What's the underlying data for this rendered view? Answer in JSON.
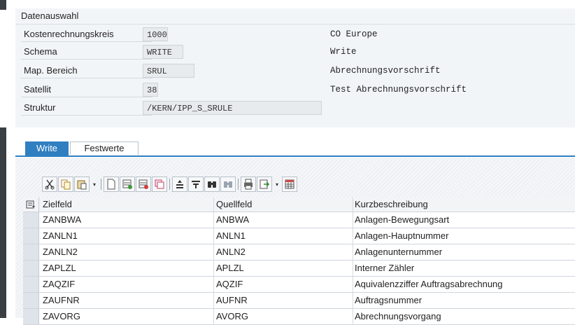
{
  "group": {
    "title": "Datenauswahl",
    "fields": [
      {
        "label": "Kostenrechnungskreis",
        "value": "1000",
        "description": "CO Europe"
      },
      {
        "label": "Schema",
        "value": "WRITE",
        "description": "Write"
      },
      {
        "label": "Map. Bereich",
        "value": "SRUL",
        "description": "Abrechnungsvorschrift"
      },
      {
        "label": "Satellit",
        "value": "38",
        "description": "Test Abrechnungsvorschrift"
      },
      {
        "label": "Struktur",
        "value": "/KERN/IPP_S_SRULE",
        "description": ""
      }
    ]
  },
  "tabs": [
    {
      "label": "Write",
      "active": true
    },
    {
      "label": "Festwerte",
      "active": false
    }
  ],
  "toolbar": {
    "icons": [
      "cut-icon",
      "copy-icon",
      "paste-icon",
      "new-row-icon",
      "insert-row-icon",
      "delete-row-icon",
      "duplicate-row-icon",
      "sort-ascending-icon",
      "filter-icon",
      "find-icon",
      "find-next-icon",
      "print-icon",
      "export-icon",
      "layout-icon"
    ]
  },
  "table": {
    "columns": [
      "Zielfeld",
      "Quellfeld",
      "Kurzbeschreibung"
    ],
    "rows": [
      [
        "ZANBWA",
        "ANBWA",
        "Anlagen-Bewegungsart"
      ],
      [
        "ZANLN1",
        "ANLN1",
        "Anlagen-Hauptnummer"
      ],
      [
        "ZANLN2",
        "ANLN2",
        "Anlagenunternummer"
      ],
      [
        "ZAPLZL",
        "APLZL",
        "Interner Zähler"
      ],
      [
        "ZAQZIF",
        "AQZIF",
        "Aquivalenzziffer Auftragsabrechnung"
      ],
      [
        "ZAUFNR",
        "AUFNR",
        "Auftragsnummer"
      ],
      [
        "ZAVORG",
        "AVORG",
        "Abrechnungsvorgang"
      ]
    ]
  },
  "colors": {
    "accent": "#2f7fc1",
    "group_bg": "#f2f5f8",
    "field_bg": "#e8ebee"
  }
}
